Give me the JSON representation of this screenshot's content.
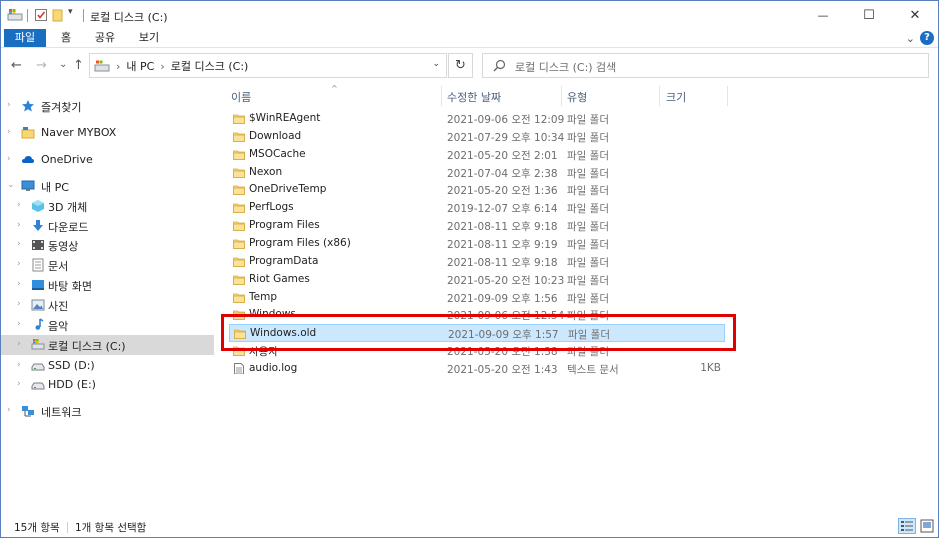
{
  "window": {
    "title": "로컬 디스크 (C:)",
    "minimize_glyph": "—",
    "maximize_glyph": "☐",
    "close_glyph": "✕"
  },
  "ribbon": {
    "tabs": [
      "파일",
      "홈",
      "공유",
      "보기"
    ],
    "expand_glyph": "⌄",
    "help_glyph": "?"
  },
  "nav": {
    "back_glyph": "←",
    "forward_glyph": "→",
    "recent_glyph": "⌄",
    "up_glyph": "↑",
    "breadcrumb": [
      "내 PC",
      "로컬 디스크 (C:)"
    ],
    "breadcrumb_sep": "›",
    "dropdown_glyph": "⌄",
    "refresh_glyph": "↻",
    "search_placeholder": "로컬 디스크 (C:) 검색"
  },
  "sidebar": {
    "items": [
      {
        "label": "즐겨찾기",
        "icon": "star-icon"
      },
      {
        "label": "Naver MYBOX",
        "icon": "cloud-folder-icon"
      },
      {
        "label": "OneDrive",
        "icon": "onedrive-icon"
      },
      {
        "label": "내 PC",
        "icon": "pc-icon"
      },
      {
        "label": "3D 개체",
        "icon": "cube-icon"
      },
      {
        "label": "다운로드",
        "icon": "download-icon"
      },
      {
        "label": "동영상",
        "icon": "video-icon"
      },
      {
        "label": "문서",
        "icon": "document-icon"
      },
      {
        "label": "바탕 화면",
        "icon": "desktop-icon"
      },
      {
        "label": "사진",
        "icon": "pictures-icon"
      },
      {
        "label": "음악",
        "icon": "music-icon"
      },
      {
        "label": "로컬 디스크 (C:)",
        "icon": "system-drive-icon"
      },
      {
        "label": "SSD (D:)",
        "icon": "drive-icon"
      },
      {
        "label": "HDD (E:)",
        "icon": "drive-icon"
      },
      {
        "label": "네트워크",
        "icon": "network-icon"
      }
    ]
  },
  "columns": {
    "name": "이름",
    "date": "수정한 날짜",
    "type": "유형",
    "size": "크기"
  },
  "files": [
    {
      "name": "$WinREAgent",
      "date": "2021-09-06 오전 12:09",
      "type": "파일 폴더",
      "size": "",
      "icon": "folder-icon"
    },
    {
      "name": "Download",
      "date": "2021-07-29 오후 10:34",
      "type": "파일 폴더",
      "size": "",
      "icon": "folder-icon"
    },
    {
      "name": "MSOCache",
      "date": "2021-05-20 오전 2:01",
      "type": "파일 폴더",
      "size": "",
      "icon": "folder-icon"
    },
    {
      "name": "Nexon",
      "date": "2021-07-04 오후 2:38",
      "type": "파일 폴더",
      "size": "",
      "icon": "folder-icon"
    },
    {
      "name": "OneDriveTemp",
      "date": "2021-05-20 오전 1:36",
      "type": "파일 폴더",
      "size": "",
      "icon": "folder-icon"
    },
    {
      "name": "PerfLogs",
      "date": "2019-12-07 오후 6:14",
      "type": "파일 폴더",
      "size": "",
      "icon": "folder-icon"
    },
    {
      "name": "Program Files",
      "date": "2021-08-11 오후 9:18",
      "type": "파일 폴더",
      "size": "",
      "icon": "folder-icon"
    },
    {
      "name": "Program Files (x86)",
      "date": "2021-08-11 오후 9:19",
      "type": "파일 폴더",
      "size": "",
      "icon": "folder-icon"
    },
    {
      "name": "ProgramData",
      "date": "2021-08-11 오후 9:18",
      "type": "파일 폴더",
      "size": "",
      "icon": "folder-icon"
    },
    {
      "name": "Riot Games",
      "date": "2021-05-20 오전 10:23",
      "type": "파일 폴더",
      "size": "",
      "icon": "folder-icon"
    },
    {
      "name": "Temp",
      "date": "2021-09-09 오후 1:56",
      "type": "파일 폴더",
      "size": "",
      "icon": "folder-icon"
    },
    {
      "name": "Windows",
      "date": "2021-09-06 오전 12:54",
      "type": "파일 폴더",
      "size": "",
      "icon": "folder-icon"
    },
    {
      "name": "Windows.old",
      "date": "2021-09-09 오후 1:57",
      "type": "파일 폴더",
      "size": "",
      "icon": "folder-icon"
    },
    {
      "name": "사용자",
      "date": "2021-05-20 오전 1:38",
      "type": "파일 폴더",
      "size": "",
      "icon": "folder-icon"
    },
    {
      "name": "audio.log",
      "date": "2021-05-20 오전 1:43",
      "type": "텍스트 문서",
      "size": "1KB",
      "icon": "text-file-icon"
    }
  ],
  "selected_file": "Windows.old",
  "status": {
    "item_count": "15개 항목",
    "selection": "1개 항목 선택함"
  },
  "colors": {
    "accent": "#1a6ec2",
    "selection_bg": "#cce8ff",
    "selection_border": "#99d1ff",
    "highlight_box": "#e00000",
    "folder": "#f8d775"
  }
}
